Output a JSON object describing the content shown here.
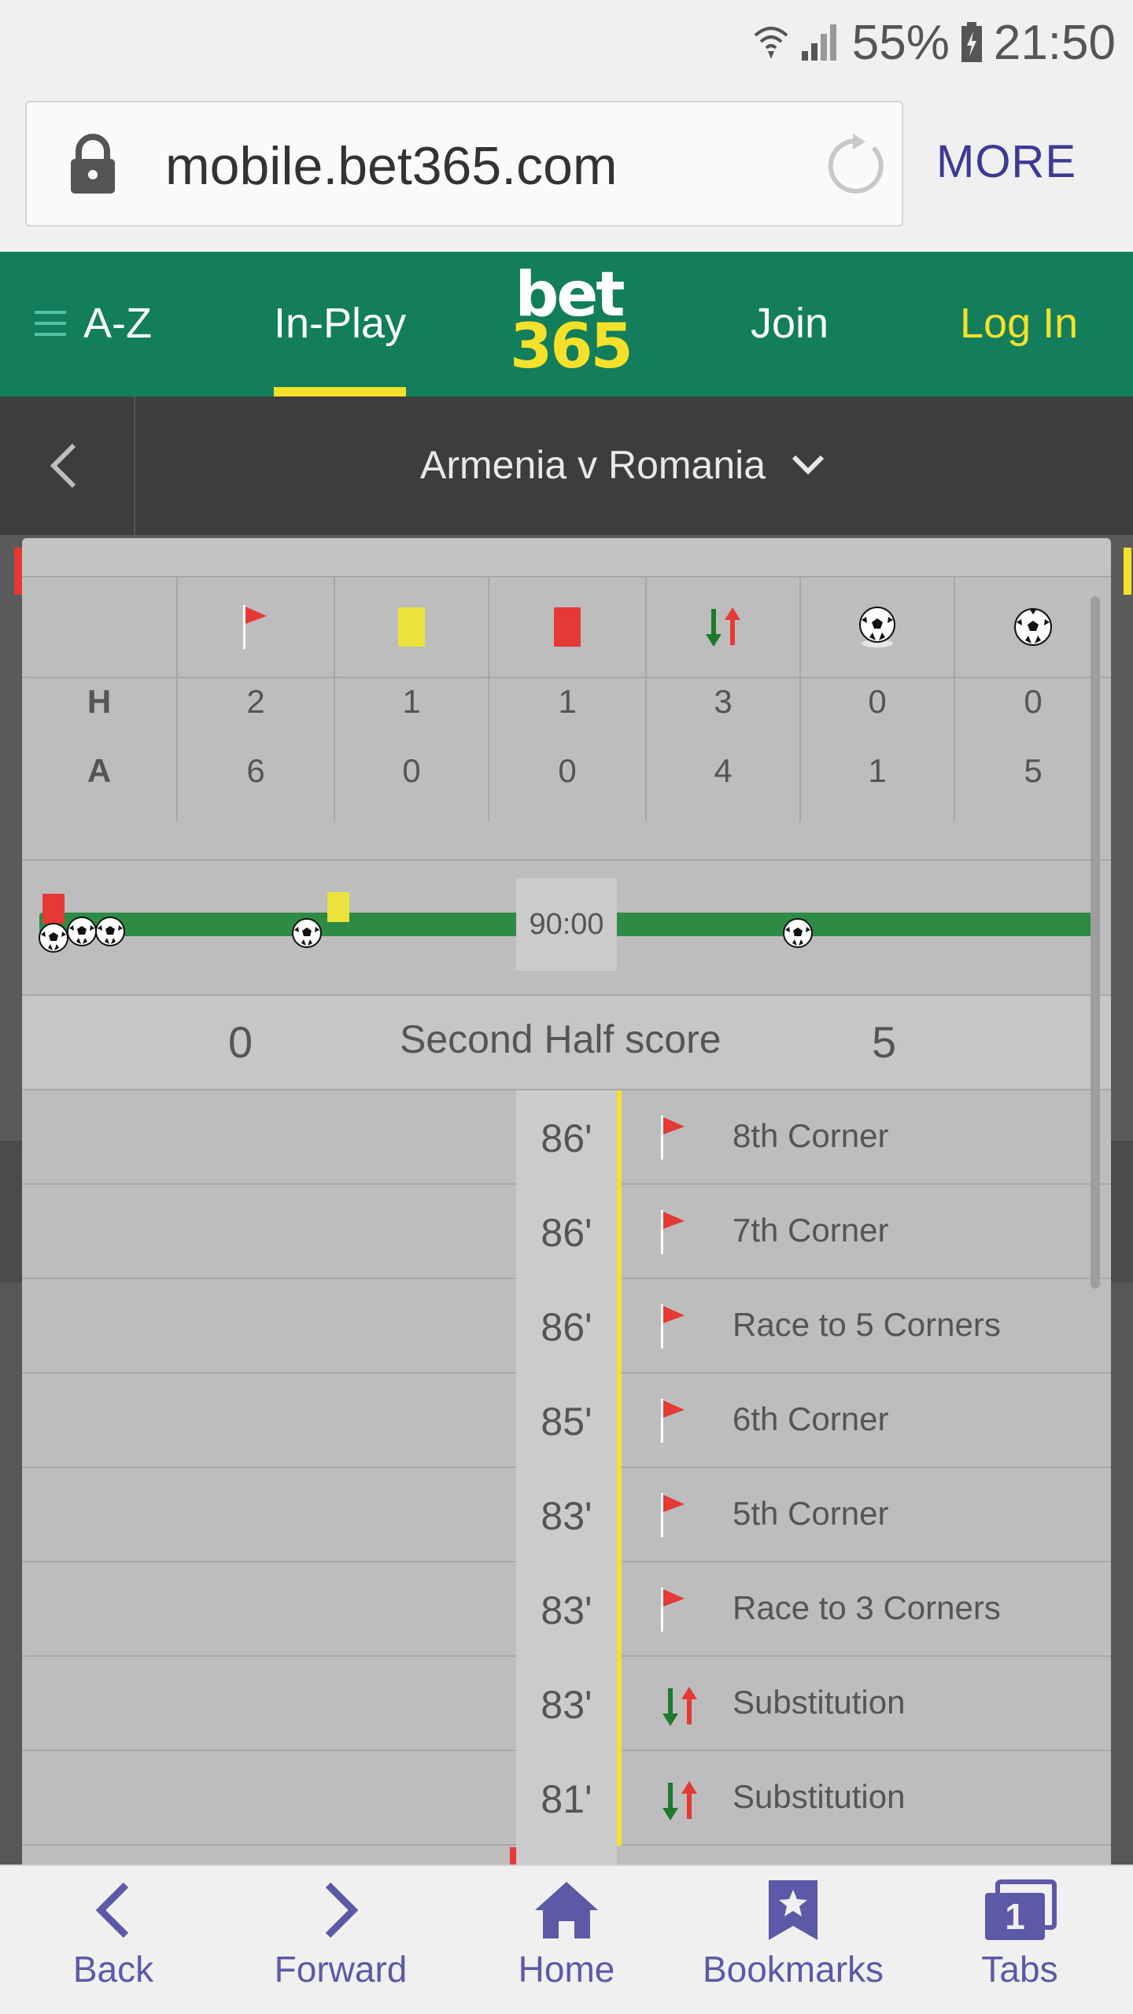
{
  "status_bar": {
    "battery": "55%",
    "time": "21:50"
  },
  "browser": {
    "url": "mobile.bet365.com",
    "more_label": "MORE"
  },
  "header": {
    "az_label": "A-Z",
    "inplay_label": "In-Play",
    "logo_top": "bet",
    "logo_bottom": "365",
    "join_label": "Join",
    "login_label": "Log In",
    "brand_green": "#137e5b",
    "accent_yellow": "#f5e12a"
  },
  "match": {
    "title": "Armenia v Romania"
  },
  "stats": {
    "row_labels": {
      "home": "H",
      "away": "A"
    },
    "columns": [
      {
        "icon": "corner-flag-icon",
        "home": "2",
        "away": "6"
      },
      {
        "icon": "yellow-card-icon",
        "home": "1",
        "away": "0"
      },
      {
        "icon": "red-card-icon",
        "home": "1",
        "away": "0"
      },
      {
        "icon": "substitution-icon",
        "home": "3",
        "away": "4"
      },
      {
        "icon": "goal-ball-icon",
        "home": "0",
        "away": "1"
      },
      {
        "icon": "goal-ball-icon",
        "home": "0",
        "away": "5"
      }
    ]
  },
  "timeline": {
    "clock": "90:00"
  },
  "half_score": {
    "label": "Second Half score",
    "home": "0",
    "away": "5"
  },
  "events": [
    {
      "minute": "86'",
      "icon": "corner-flag-icon",
      "text": "8th Corner"
    },
    {
      "minute": "86'",
      "icon": "corner-flag-icon",
      "text": "7th Corner"
    },
    {
      "minute": "86'",
      "icon": "corner-flag-icon",
      "text": "Race to 5 Corners"
    },
    {
      "minute": "85'",
      "icon": "corner-flag-icon",
      "text": "6th Corner"
    },
    {
      "minute": "83'",
      "icon": "corner-flag-icon",
      "text": "5th Corner"
    },
    {
      "minute": "83'",
      "icon": "corner-flag-icon",
      "text": "Race to 3 Corners"
    },
    {
      "minute": "83'",
      "icon": "substitution-icon",
      "text": "Substitution"
    },
    {
      "minute": "81'",
      "icon": "substitution-icon",
      "text": "Substitution"
    }
  ],
  "bottom_nav": {
    "back": "Back",
    "forward": "Forward",
    "home": "Home",
    "bookmarks": "Bookmarks",
    "tabs": "Tabs",
    "tabs_count": "1"
  }
}
